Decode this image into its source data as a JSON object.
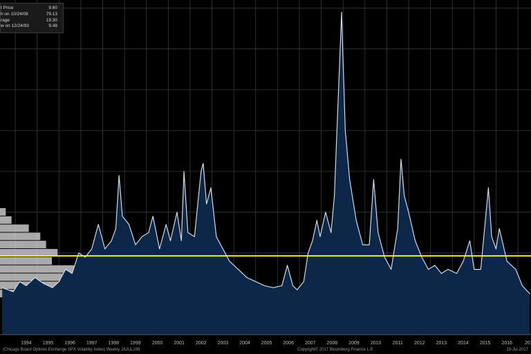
{
  "legend": {
    "rows": [
      {
        "label": "t Price",
        "value": "9.60"
      },
      {
        "label": "h on 10/24/08",
        "value": "79.13"
      },
      {
        "label": "rage",
        "value": "19.30"
      },
      {
        "label": "w on 12/24/93",
        "value": "9.48"
      }
    ]
  },
  "footer": {
    "left": "(Chicago Board Options Exchange SPX Volatility Index)   Weekly 28JUL199",
    "center": "Copyright© 2017 Bloomberg Finance L.P.",
    "right": "19-Jul-2017"
  },
  "colors": {
    "background": "#000000",
    "area_fill": "#0d2748",
    "line": "#d0dbe6",
    "average_line": "#f5ef12",
    "histogram": "#c8c8c8",
    "grid": "#3a3a3a",
    "axis_text": "#bdbdbd"
  },
  "chart_data": {
    "type": "area",
    "x_ticks": [
      "1994",
      "1995",
      "1996",
      "1997",
      "1998",
      "1999",
      "2000",
      "2001",
      "2002",
      "2003",
      "2004",
      "2005",
      "2006",
      "2007",
      "2008",
      "2009",
      "2010",
      "2011",
      "2012",
      "2013",
      "2014",
      "2015",
      "2016",
      "201"
    ],
    "average": 19.3,
    "ylim": [
      0,
      82
    ],
    "xlim": [
      1993.3,
      2017.6
    ],
    "grid": true,
    "series": [
      {
        "x": [
          1993.4,
          1993.9,
          1994.2,
          1994.5,
          1994.9,
          1995.3,
          1995.7,
          1996.0,
          1996.3,
          1996.6,
          1996.9,
          1997.2,
          1997.5,
          1997.8,
          1998.1,
          1998.4,
          1998.6,
          1998.75,
          1998.9,
          1999.2,
          1999.5,
          1999.8,
          2000.1,
          2000.3,
          2000.6,
          2000.9,
          2001.1,
          2001.4,
          2001.6,
          2001.72,
          2001.9,
          2002.2,
          2002.5,
          2002.6,
          2002.75,
          2002.95,
          2003.2,
          2003.5,
          2003.8,
          2004.2,
          2004.6,
          2005.0,
          2005.4,
          2005.8,
          2006.2,
          2006.45,
          2006.7,
          2006.9,
          2007.2,
          2007.4,
          2007.6,
          2007.8,
          2007.95,
          2008.2,
          2008.45,
          2008.6,
          2008.8,
          2008.93,
          2009.1,
          2009.3,
          2009.6,
          2009.9,
          2010.2,
          2010.4,
          2010.6,
          2010.9,
          2011.2,
          2011.5,
          2011.65,
          2011.8,
          2012.0,
          2012.3,
          2012.6,
          2012.9,
          2013.2,
          2013.5,
          2013.8,
          2014.2,
          2014.5,
          2014.8,
          2015.0,
          2015.3,
          2015.65,
          2015.8,
          2016.0,
          2016.15,
          2016.5,
          2016.9,
          2017.2,
          2017.55
        ],
        "values": [
          11.5,
          10.5,
          13,
          12,
          14,
          12.5,
          11.5,
          13,
          16,
          15,
          20,
          19,
          21,
          27,
          21,
          23,
          26,
          39,
          29,
          27,
          22,
          24,
          25,
          29,
          21,
          27,
          23,
          30,
          23,
          40,
          25,
          24,
          40,
          42,
          32,
          36,
          24,
          21,
          18,
          16,
          14,
          13,
          12,
          11.5,
          12,
          17,
          12,
          11,
          13,
          20,
          23,
          28,
          24,
          30,
          25,
          34,
          61,
          79,
          50,
          38,
          28,
          22,
          22,
          38,
          25,
          19,
          16,
          26,
          43,
          34,
          30,
          23,
          19,
          16,
          17,
          15,
          16,
          15,
          18,
          23,
          16,
          16,
          36,
          24,
          21,
          26,
          18,
          16,
          12,
          10
        ]
      }
    ],
    "histogram": {
      "bins": [
        {
          "level": 30,
          "count": 1
        },
        {
          "level": 28,
          "count": 2
        },
        {
          "level": 26,
          "count": 5
        },
        {
          "level": 24,
          "count": 7
        },
        {
          "level": 22,
          "count": 8
        },
        {
          "level": 20,
          "count": 10
        },
        {
          "level": 18,
          "count": 9
        },
        {
          "level": 16,
          "count": 13
        },
        {
          "level": 14,
          "count": 20
        },
        {
          "level": 12,
          "count": 21
        },
        {
          "level": 10,
          "count": 7
        }
      ],
      "max_count": 21
    }
  }
}
